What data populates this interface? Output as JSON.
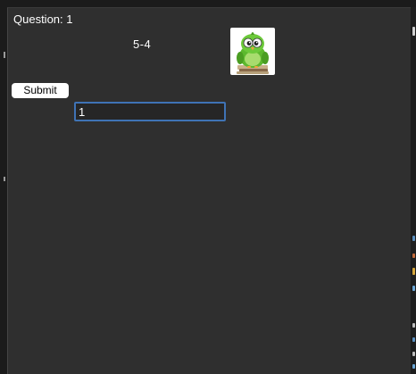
{
  "quiz": {
    "question_label": "Question: 1",
    "problem_text": "5-4",
    "mascot_icon": "green-bird-icon",
    "submit_label": "Submit",
    "answer_value": "1"
  },
  "colors": {
    "window_background": "#2f2f2f",
    "input_focus_border": "#3f73b5",
    "mascot_green": "#5cb82e"
  }
}
